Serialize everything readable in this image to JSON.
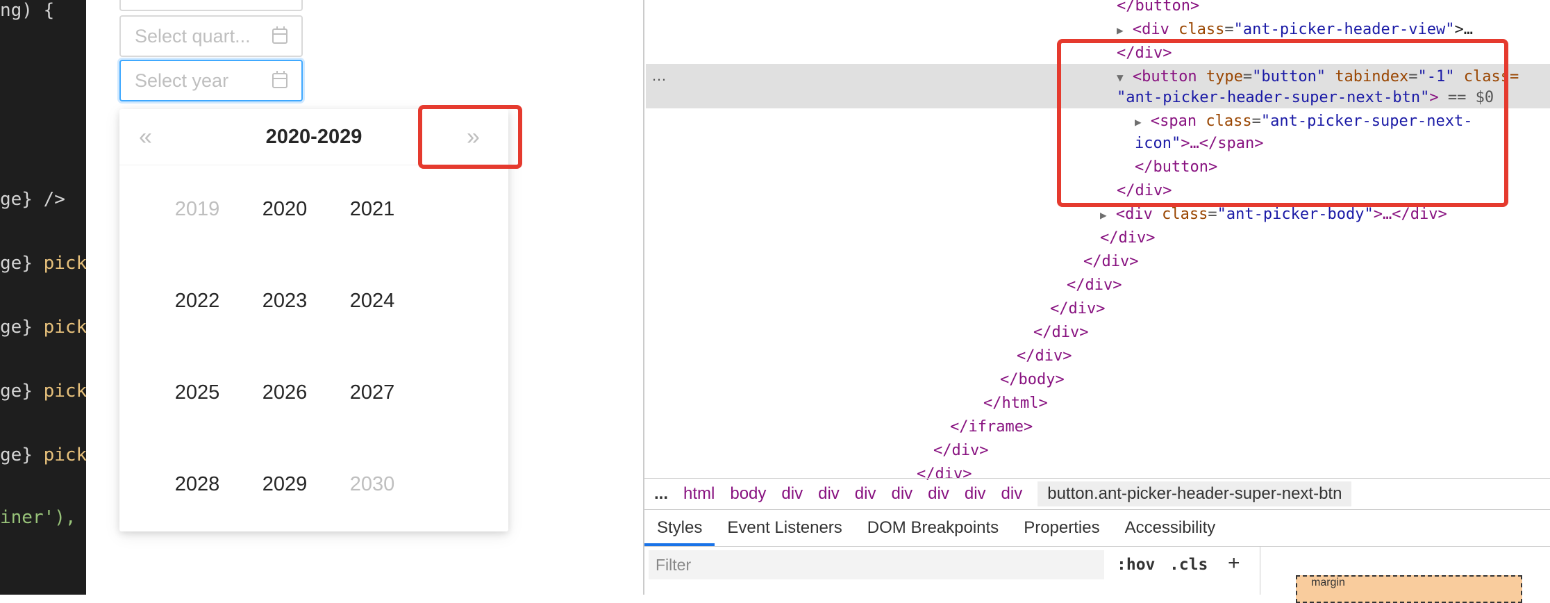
{
  "code": {
    "lines": [
      {
        "pre": "ng) {",
        "kw": "",
        "post": ""
      },
      {
        "pre": "ge} />",
        "kw": "",
        "post": ""
      },
      {
        "pre": "ge} ",
        "kw": "pick",
        "post": ""
      },
      {
        "pre": "ge} ",
        "kw": "pick",
        "post": ""
      },
      {
        "pre": "ge} ",
        "kw": "pick",
        "post": ""
      },
      {
        "pre": "ge} ",
        "kw": "pick",
        "post": ""
      },
      {
        "pre": "iner'),",
        "kw": "",
        "post": ""
      }
    ]
  },
  "preview": {
    "quarter_placeholder": "Select quart...",
    "year_placeholder": "Select year",
    "panel": {
      "prev_label": "«",
      "next_label": "»",
      "decade": "2020-2029",
      "years": [
        {
          "label": "2019",
          "out": true
        },
        {
          "label": "2020",
          "out": false
        },
        {
          "label": "2021",
          "out": false
        },
        {
          "label": "2022",
          "out": false
        },
        {
          "label": "2023",
          "out": false
        },
        {
          "label": "2024",
          "out": false
        },
        {
          "label": "2025",
          "out": false
        },
        {
          "label": "2026",
          "out": false
        },
        {
          "label": "2027",
          "out": false
        },
        {
          "label": "2028",
          "out": false
        },
        {
          "label": "2029",
          "out": false
        },
        {
          "label": "2030",
          "out": true
        }
      ]
    }
  },
  "devtools": {
    "dom": {
      "l1": "</button>",
      "l2_tag": "<div ",
      "l2_attr": "class",
      "l2_val": "\"ant-picker-header-view\"",
      "l2_end": ">…",
      "l3": "</div>",
      "l4_tag": "<button ",
      "l4_attr1": "type",
      "l4_val1": "\"button\"",
      "l4_attr2": "tabindex",
      "l4_val2": "\"-1\"",
      "l4_attr3": "class=",
      "l5_val": "ant-picker-header-super-next-btn\"",
      "l5_end": ">",
      "l5_eq": " == $0",
      "l6_tag": "<span ",
      "l6_attr": "class",
      "l6_val": "\"ant-picker-super-next-",
      "l7_val": "icon\"",
      "l7_end": ">…</span>",
      "l8": "</button>",
      "l9": "</div>",
      "l10_tag": "<div ",
      "l10_attr": "class",
      "l10_val": "\"ant-picker-body\"",
      "l10_end": ">…</div>",
      "closing": [
        "</div>",
        "</div>",
        "</div>",
        "</div>",
        "</div>",
        "</div>",
        "</body>",
        "</html>",
        "</iframe>",
        "</div>",
        "</div>"
      ]
    },
    "breadcrumb": {
      "ellipsis": "...",
      "items": [
        "html",
        "body",
        "div",
        "div",
        "div",
        "div",
        "div",
        "div",
        "div"
      ],
      "current": "button.ant-picker-header-super-next-btn"
    },
    "tabs": [
      "Styles",
      "Event Listeners",
      "DOM Breakpoints",
      "Properties",
      "Accessibility"
    ],
    "filter_placeholder": "Filter",
    "hov": ":hov",
    "cls": ".cls",
    "plus": "+",
    "margin_label": "margin"
  }
}
